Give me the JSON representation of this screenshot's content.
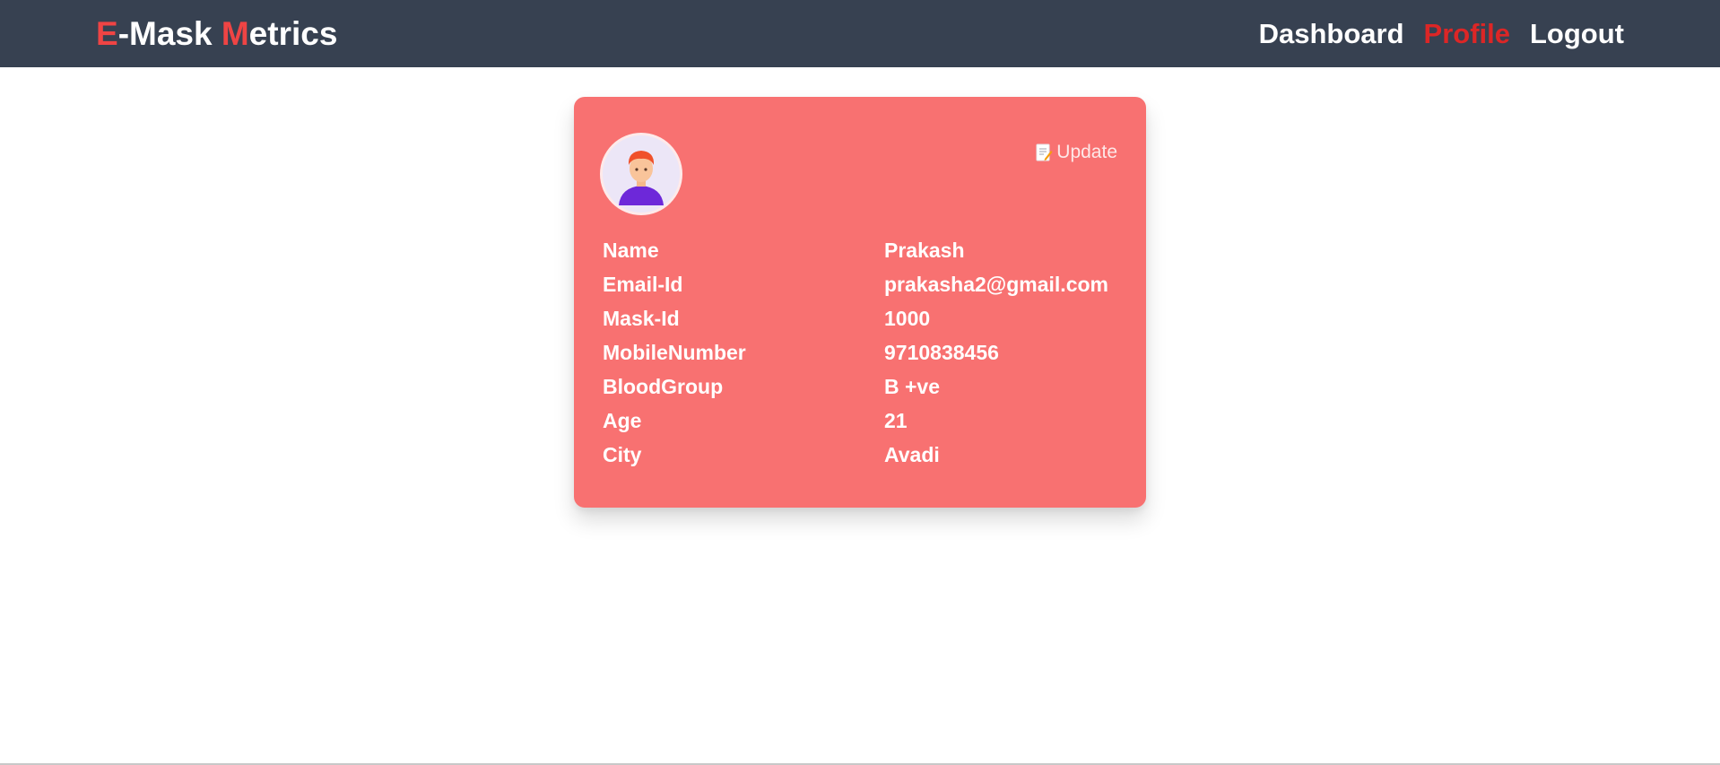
{
  "brand": {
    "e": "E",
    "mid": "-Mask ",
    "m": "M",
    "rest": "etrics"
  },
  "nav": {
    "dashboard": "Dashboard",
    "profile": "Profile",
    "logout": "Logout"
  },
  "colors": {
    "navbar": "#374151",
    "accent": "#ef4444",
    "card": "#f87171"
  },
  "card": {
    "update_label": "Update",
    "update_icon": "memo-icon",
    "avatar_icon": "user-avatar-icon",
    "fields": [
      {
        "label": "Name",
        "value": "Prakash"
      },
      {
        "label": "Email-Id",
        "value": "prakasha2@gmail.com"
      },
      {
        "label": "Mask-Id",
        "value": "1000"
      },
      {
        "label": "MobileNumber",
        "value": "9710838456"
      },
      {
        "label": "BloodGroup",
        "value": "B +ve"
      },
      {
        "label": "Age",
        "value": "21"
      },
      {
        "label": "City",
        "value": "Avadi"
      }
    ]
  }
}
